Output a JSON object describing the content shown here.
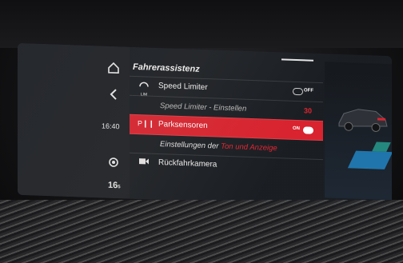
{
  "menu": {
    "title": "Fahrerassistenz",
    "items": [
      {
        "label": "Speed Limiter",
        "toggle_text": "OFF",
        "icon": "speed-limiter-icon",
        "icon_text": "LIM"
      },
      {
        "label": "Speed Limiter - Einstellen",
        "value": "30"
      },
      {
        "label": "Parksensoren",
        "toggle_text": "ON",
        "icon": "park-sensor-icon",
        "icon_text": "P❙❙",
        "active": true
      },
      {
        "label": "Einstellungen der ",
        "label_highlight": "Ton und Anzeige"
      },
      {
        "label": "Rückfahrkamera",
        "icon": "camera-icon"
      }
    ]
  },
  "rail": {
    "time": "16:40",
    "temp": "16",
    "temp_unit": "5"
  },
  "colors": {
    "accent": "#d81f2b",
    "text": "#f0f0f0",
    "value_red": "#e4202c"
  }
}
